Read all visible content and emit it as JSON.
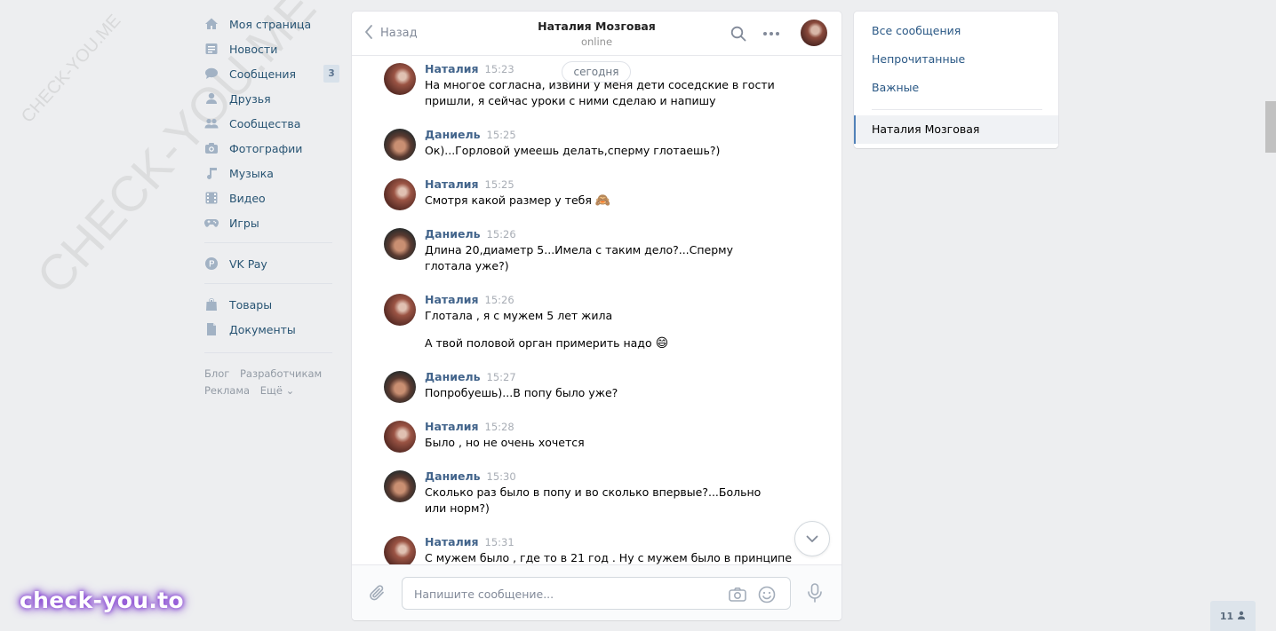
{
  "left_nav": {
    "items": [
      {
        "label": "Моя страница",
        "icon": "home-icon"
      },
      {
        "label": "Новости",
        "icon": "news-icon"
      },
      {
        "label": "Сообщения",
        "icon": "messages-icon",
        "badge": "3"
      },
      {
        "label": "Друзья",
        "icon": "friends-icon"
      },
      {
        "label": "Сообщества",
        "icon": "communities-icon"
      },
      {
        "label": "Фотографии",
        "icon": "camera-icon"
      },
      {
        "label": "Музыка",
        "icon": "music-icon"
      },
      {
        "label": "Видео",
        "icon": "video-icon"
      },
      {
        "label": "Игры",
        "icon": "games-icon"
      }
    ],
    "pay": {
      "label": "VK Pay",
      "icon": "vkpay-icon"
    },
    "extra": [
      {
        "label": "Товары",
        "icon": "bag-icon"
      },
      {
        "label": "Документы",
        "icon": "document-icon"
      }
    ],
    "footer": {
      "blog": "Блог",
      "dev": "Разработчикам",
      "ads": "Реклама",
      "more": "Ещё ⌄"
    }
  },
  "chat": {
    "back_label": "Назад",
    "peer_name": "Наталия Мозговая",
    "peer_status": "online",
    "date_label": "сегодня",
    "messages": [
      {
        "author": "Наталия",
        "time": "15:23",
        "lines": [
          "На многое согласна, извини у меня дети соседские в гости пришли, я сейчас уроки с ними сделаю и напишу"
        ]
      },
      {
        "author": "Даниель",
        "time": "15:25",
        "lines": [
          "Ок)...Горловой умеешь делать,сперму глотаешь?)"
        ]
      },
      {
        "author": "Наталия",
        "time": "15:25",
        "lines": [
          "Смотря какой размер у тебя"
        ],
        "emoji": "🙈"
      },
      {
        "author": "Даниель",
        "time": "15:26",
        "lines": [
          "Длина 20,диаметр 5...Имела с таким дело?...Сперму глотала уже?)"
        ]
      },
      {
        "author": "Наталия",
        "time": "15:26",
        "lines": [
          "Глотала , я с мужем 5 лет жила",
          "А твой половой орган примерить надо"
        ],
        "emoji": "😄"
      },
      {
        "author": "Даниель",
        "time": "15:27",
        "lines": [
          "Попробуешь)...В попу было уже?"
        ]
      },
      {
        "author": "Наталия",
        "time": "15:28",
        "lines": [
          "Было , но не очень хочется"
        ]
      },
      {
        "author": "Даниель",
        "time": "15:30",
        "lines": [
          "Сколько раз было в попу и во сколько впервые?...Больно или норм?)"
        ]
      },
      {
        "author": "Наталия",
        "time": "15:31",
        "lines": [
          "С мужем было , где то в 21 год . Ну с мужем было в принципе"
        ]
      }
    ],
    "composer_placeholder": "Напишите сообщение..."
  },
  "right_panel": {
    "all": "Все сообщения",
    "unread": "Непрочитанные",
    "important": "Важные",
    "active": "Наталия Мозговая"
  },
  "online_count": "11",
  "watermarks": {
    "diagonal": "CHECK-YOU.ME",
    "brand": "check-you.to"
  },
  "colors": {
    "link": "#2a5885",
    "author": "#42648b",
    "accent": "#5181b8",
    "page_bg": "#edeef0"
  }
}
